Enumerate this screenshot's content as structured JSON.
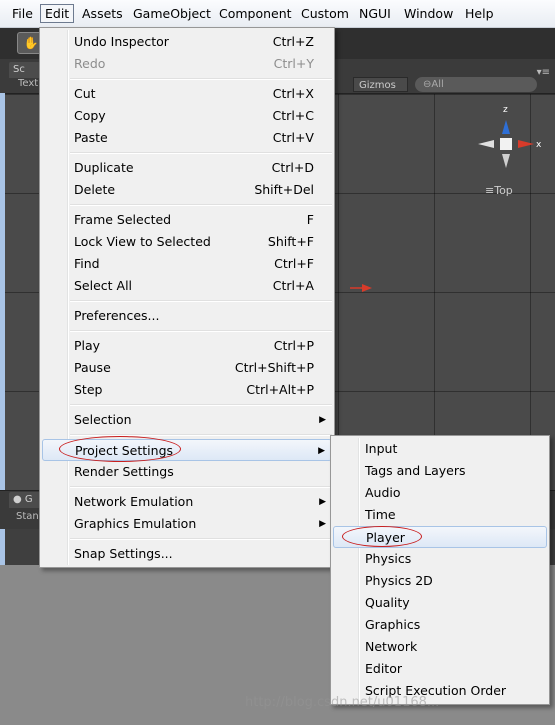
{
  "menubar": {
    "items": [
      "File",
      "Edit",
      "Assets",
      "GameObject",
      "Component",
      "Custom",
      "NGUI",
      "Window",
      "Help"
    ]
  },
  "editor": {
    "scene_tab": "Sc",
    "scene_sub": "Text",
    "gizmos": "Gizmos",
    "search": "⊖All",
    "view_label": "≡Top",
    "axis_z": "z",
    "axis_x": "x",
    "game_tab": "G",
    "game_sub": "Stan",
    "pane_menu": "▾≡"
  },
  "edit_menu": {
    "undo": {
      "label": "Undo Inspector",
      "shortcut": "Ctrl+Z"
    },
    "redo": {
      "label": "Redo",
      "shortcut": "Ctrl+Y"
    },
    "cut": {
      "label": "Cut",
      "shortcut": "Ctrl+X"
    },
    "copy": {
      "label": "Copy",
      "shortcut": "Ctrl+C"
    },
    "paste": {
      "label": "Paste",
      "shortcut": "Ctrl+V"
    },
    "duplicate": {
      "label": "Duplicate",
      "shortcut": "Ctrl+D"
    },
    "delete": {
      "label": "Delete",
      "shortcut": "Shift+Del"
    },
    "frame_selected": {
      "label": "Frame Selected",
      "shortcut": "F"
    },
    "lock_view": {
      "label": "Lock View to Selected",
      "shortcut": "Shift+F"
    },
    "find": {
      "label": "Find",
      "shortcut": "Ctrl+F"
    },
    "select_all": {
      "label": "Select All",
      "shortcut": "Ctrl+A"
    },
    "preferences": {
      "label": "Preferences..."
    },
    "play": {
      "label": "Play",
      "shortcut": "Ctrl+P"
    },
    "pause": {
      "label": "Pause",
      "shortcut": "Ctrl+Shift+P"
    },
    "step": {
      "label": "Step",
      "shortcut": "Ctrl+Alt+P"
    },
    "selection": {
      "label": "Selection"
    },
    "project_settings": {
      "label": "Project Settings"
    },
    "render_settings": {
      "label": "Render Settings"
    },
    "network_emulation": {
      "label": "Network Emulation"
    },
    "graphics_emulation": {
      "label": "Graphics Emulation"
    },
    "snap_settings": {
      "label": "Snap Settings..."
    }
  },
  "project_settings_submenu": {
    "items": [
      "Input",
      "Tags and Layers",
      "Audio",
      "Time",
      "Player",
      "Physics",
      "Physics 2D",
      "Quality",
      "Graphics",
      "Network",
      "Editor",
      "Script Execution Order"
    ]
  },
  "watermark": "http://blog.csdn.net/u01168..."
}
